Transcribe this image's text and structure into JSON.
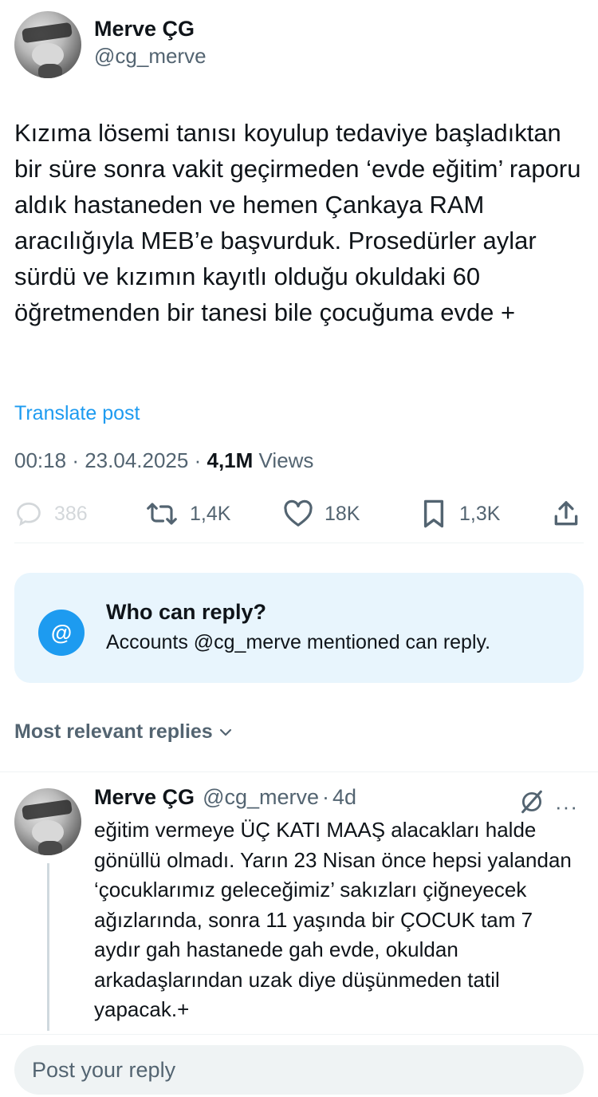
{
  "author": {
    "name": "Merve ÇG",
    "handle": "@cg_merve"
  },
  "tweet": {
    "text": "Kızıma lösemi tanısı koyulup tedaviye başladıktan bir süre sonra vakit geçirmeden ‘evde eğitim’ raporu aldık hastaneden ve hemen Çankaya RAM aracılığıyla MEB’e başvurduk. Prosedürler aylar sürdü ve kızımın kayıtlı olduğu okuldaki 60 öğretmenden bir tanesi bile çocuğuma evde +",
    "translate_label": "Translate post",
    "time": "00:18",
    "date": "23.04.2025",
    "views_count": "4,1M",
    "views_label": "Views",
    "separator": "·"
  },
  "actions": {
    "replies": "386",
    "reposts": "1,4K",
    "likes": "18K",
    "bookmarks": "1,3K",
    "icons": [
      "reply-icon",
      "retweet-icon",
      "heart-icon",
      "bookmark-icon",
      "share-icon"
    ]
  },
  "who_can_reply": {
    "icon_symbol": "@",
    "title": "Who can reply?",
    "subtitle": "Accounts @cg_merve mentioned can reply."
  },
  "sort": {
    "label": "Most relevant replies"
  },
  "reply": {
    "name": "Merve ÇG",
    "handle": "@cg_merve",
    "separator": "·",
    "age": "4d",
    "more_symbol": "···",
    "text": "eğitim vermeye ÜÇ KATI MAAŞ alacakları halde gönüllü olmadı. Yarın 23 Nisan önce hepsi yalandan ‘çocuklarımız geleceğimiz’ sakızları çiğneyecek ağızlarında, sonra 11 yaşında bir ÇOCUK tam 7 aydır gah hastanede gah evde, okuldan arkadaşlarından uzak diye düşünmeden tatil yapacak.+"
  },
  "composer": {
    "placeholder": "Post your reply"
  },
  "colors": {
    "accent": "#1d9bf0",
    "secondary_text": "#536471",
    "reply_box_bg": "#e8f5fd",
    "input_bg": "#eff3f4"
  }
}
